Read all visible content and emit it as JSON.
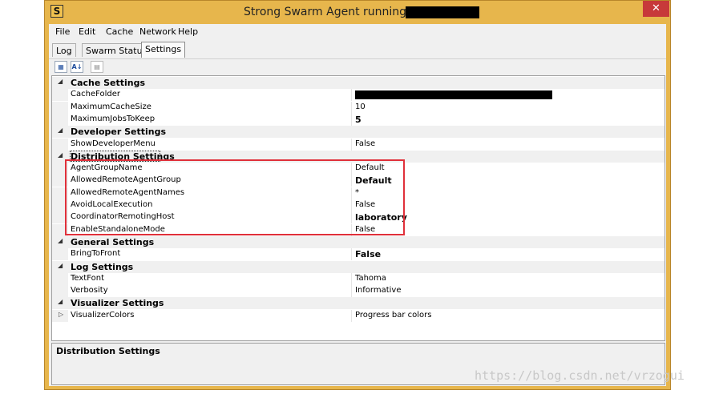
{
  "window": {
    "title": "Strong Swarm Agent running on",
    "app_icon": "swarm-s-icon",
    "close_glyph": "✕",
    "accent": "#e7b64c"
  },
  "menu": [
    "File",
    "Edit",
    "Cache",
    "Network",
    "Help"
  ],
  "tabs": [
    {
      "label": "Log",
      "active": false
    },
    {
      "label": "Swarm Status",
      "active": false
    },
    {
      "label": "Settings",
      "active": true
    }
  ],
  "toolbar": {
    "categorized_icon": "categorized-view-icon",
    "alphabetical_icon": "alphabetical-sort-icon",
    "property_pages_icon": "property-pages-icon",
    "categorized_glyph": "▦",
    "alphabetical_glyph": "A↓",
    "pages_glyph": "▤"
  },
  "grid": {
    "categories": [
      {
        "label": "Cache Settings",
        "properties": [
          {
            "name": "CacheFolder",
            "value": "",
            "redacted": true
          },
          {
            "name": "MaximumCacheSize",
            "value": "10"
          },
          {
            "name": "MaximumJobsToKeep",
            "value": "5",
            "bold": true
          }
        ]
      },
      {
        "label": "Developer Settings",
        "properties": [
          {
            "name": "ShowDeveloperMenu",
            "value": "False"
          }
        ]
      },
      {
        "label": "Distribution Settings",
        "selected": true,
        "properties": [
          {
            "name": "AgentGroupName",
            "value": "Default"
          },
          {
            "name": "AllowedRemoteAgentGroup",
            "value": "Default",
            "bold": true
          },
          {
            "name": "AllowedRemoteAgentNames",
            "value": "*"
          },
          {
            "name": "AvoidLocalExecution",
            "value": "False"
          },
          {
            "name": "CoordinatorRemotingHost",
            "value": "laboratory",
            "bold": true
          },
          {
            "name": "EnableStandaloneMode",
            "value": "False"
          }
        ]
      },
      {
        "label": "General Settings",
        "properties": [
          {
            "name": "BringToFront",
            "value": "False",
            "bold": true
          }
        ]
      },
      {
        "label": "Log Settings",
        "properties": [
          {
            "name": "TextFont",
            "value": "Tahoma"
          },
          {
            "name": "Verbosity",
            "value": "Informative"
          }
        ]
      },
      {
        "label": "Visualizer Settings",
        "properties": [
          {
            "name": "VisualizerColors",
            "value": "Progress bar colors",
            "expandable": true
          }
        ]
      }
    ]
  },
  "help_panel": {
    "title": "Distribution Settings"
  },
  "annotation": {
    "highlight_color": "#e0303a"
  },
  "watermark": "https://blog.csdn.net/vrzogui"
}
